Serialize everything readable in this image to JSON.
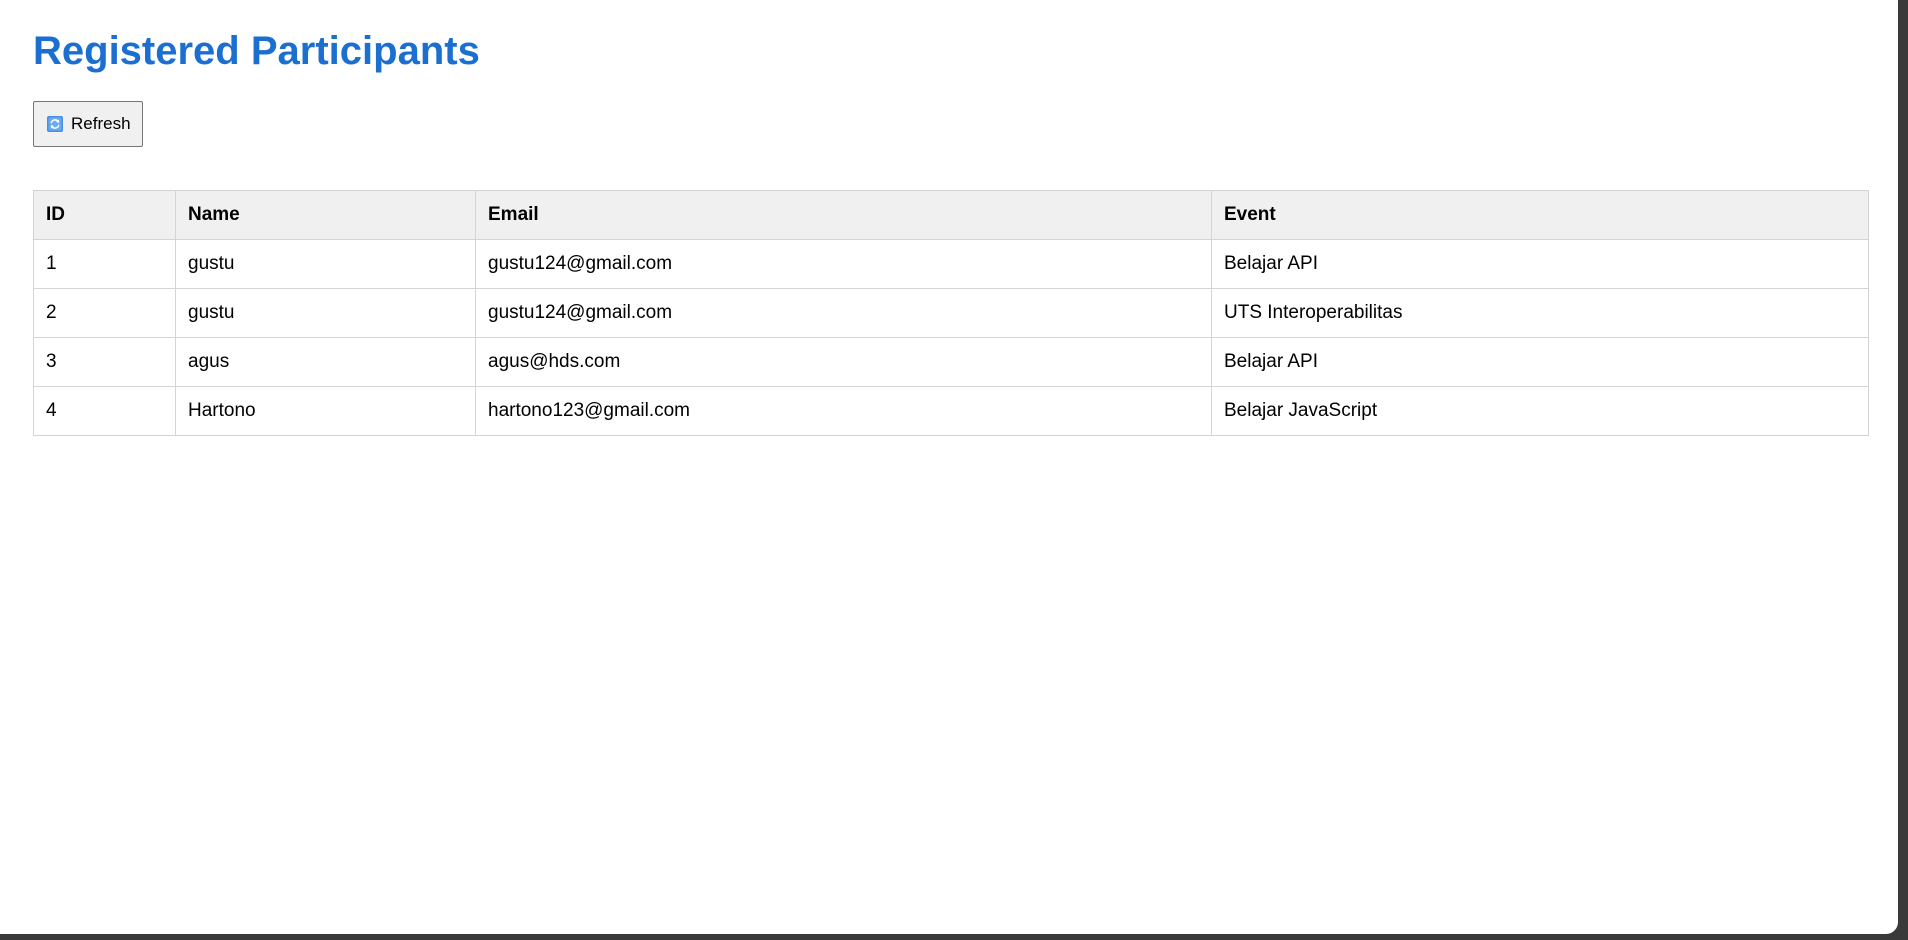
{
  "page": {
    "title": "Registered Participants",
    "title_color": "#1a6fd0"
  },
  "toolbar": {
    "refresh_label": "Refresh",
    "refresh_icon": "refresh-icon"
  },
  "table": {
    "headers": [
      "ID",
      "Name",
      "Email",
      "Event"
    ],
    "rows": [
      [
        "1",
        "gustu",
        "gustu124@gmail.com",
        "Belajar API"
      ],
      [
        "2",
        "gustu",
        "gustu124@gmail.com",
        "UTS Interoperabilitas"
      ],
      [
        "3",
        "agus",
        "agus@hds.com",
        "Belajar API"
      ],
      [
        "4",
        "Hartono",
        "hartono123@gmail.com",
        "Belajar JavaScript"
      ]
    ]
  }
}
